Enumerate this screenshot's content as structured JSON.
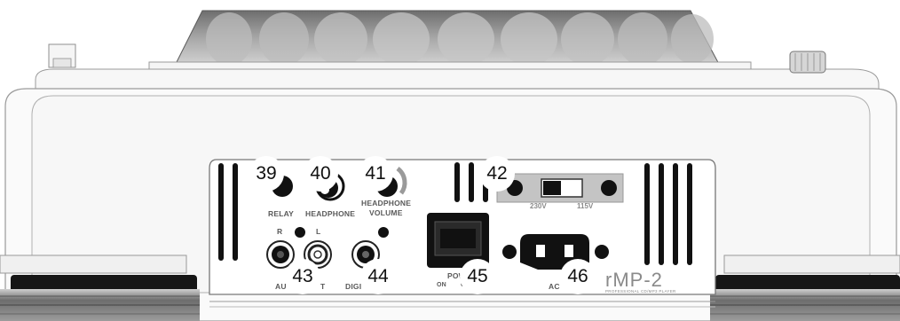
{
  "callouts": {
    "c39": "39",
    "c40": "40",
    "c41": "41",
    "c42": "42",
    "c43": "43",
    "c44": "44",
    "c45": "45",
    "c46": "46"
  },
  "panel_labels": {
    "relay": "RELAY",
    "headphone": "HEADPHONE",
    "headphone_volume_1": "HEADPHONE",
    "headphone_volume_2": "VOLUME",
    "audio_r": "R",
    "audio_l": "L",
    "audio_partial_left": "AU",
    "audio_partial_right": "T",
    "digital_partial": "DIGI",
    "power_partial": "POW",
    "power_on": "ON",
    "power_off_partial": "O",
    "ac_partial": "AC",
    "voltage_230": "230V",
    "voltage_115": "115V"
  },
  "brand": {
    "logo": "rMP-2",
    "tagline": "PROFESSIONAL CD/MP3 PLAYER"
  },
  "colors": {
    "body": "#f4f4f4",
    "outline": "#9a9a9a",
    "jack": "#111111",
    "panel_grey": "#c8c8c8"
  }
}
